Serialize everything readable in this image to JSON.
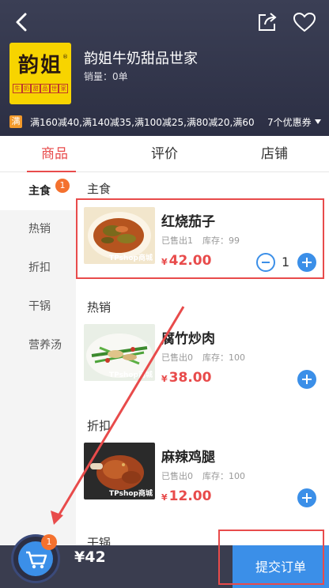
{
  "header": {
    "store_name": "韵姐牛奶甜品世家",
    "sales": "销量：0单",
    "logo": {
      "big": "韵姐",
      "small": [
        "牛",
        "奶",
        "甜",
        "品",
        "世",
        "家"
      ],
      "reg": "®"
    },
    "promo_tag": "满",
    "promo_text": "满160减40,满140减35,满100减25,满80减20,满60...",
    "coupon_label": "7个优惠券"
  },
  "tabs": [
    {
      "label": "商品",
      "active": true
    },
    {
      "label": "评价",
      "active": false
    },
    {
      "label": "店铺",
      "active": false
    }
  ],
  "sidebar": {
    "items": [
      {
        "label": "主食",
        "active": true,
        "badge": "1"
      },
      {
        "label": "热销"
      },
      {
        "label": "折扣"
      },
      {
        "label": "干锅"
      },
      {
        "label": "营养汤"
      }
    ]
  },
  "sections": [
    {
      "title": "主食",
      "item": {
        "name": "红烧茄子",
        "sold": "已售出1",
        "stock": "库存：99",
        "currency": "¥",
        "price": "42.00",
        "qty": "1",
        "watermark": "TPshop商城"
      }
    },
    {
      "title": "热销",
      "item": {
        "name": "腐竹炒肉",
        "sold": "已售出0",
        "stock": "库存：100",
        "currency": "¥",
        "price": "38.00",
        "watermark": "TPshop商城"
      }
    },
    {
      "title": "折扣",
      "item": {
        "name": "麻辣鸡腿",
        "sold": "已售出0",
        "stock": "库存：100",
        "currency": "¥",
        "price": "12.00",
        "watermark": "TPshop商城"
      }
    },
    {
      "title": "干锅"
    }
  ],
  "cart": {
    "badge": "1",
    "total": "¥42"
  },
  "submit_label": "提交订单",
  "colors": {
    "accent_red": "#e84b4b",
    "blue": "#3b8fe8",
    "header_bg": "#2c2f44",
    "badge": "#f4712e"
  }
}
